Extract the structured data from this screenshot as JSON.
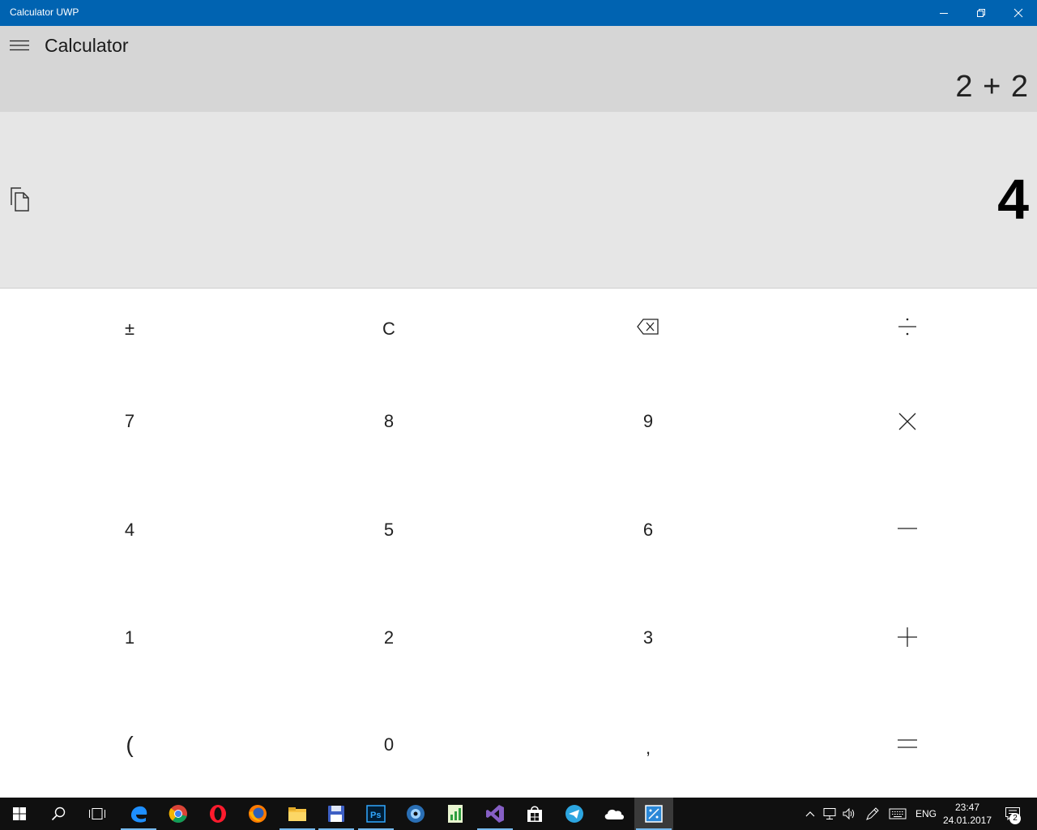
{
  "window": {
    "title": "Calculator UWP"
  },
  "header": {
    "title": "Calculator",
    "expression": "2 + 2"
  },
  "display": {
    "result": "4"
  },
  "keypad": {
    "row0": [
      "±",
      "C",
      "backspace",
      "÷"
    ],
    "row1": [
      "7",
      "8",
      "9",
      "×"
    ],
    "row2": [
      "4",
      "5",
      "6",
      "−"
    ],
    "row3": [
      "1",
      "2",
      "3",
      "+"
    ],
    "row4": [
      "(",
      "0",
      ",",
      "="
    ],
    "labels": {
      "plus_minus": "±",
      "clear": "C",
      "seven": "7",
      "eight": "8",
      "nine": "9",
      "four": "4",
      "five": "5",
      "six": "6",
      "one": "1",
      "two": "2",
      "three": "3",
      "paren": "(",
      "zero": "0",
      "comma": ","
    }
  },
  "taskbar": {
    "language": "ENG",
    "time": "23:47",
    "date": "24.01.2017",
    "notifications": "2",
    "colors": {
      "accent": "#0063b1",
      "taskbar_bg": "#101010",
      "active_indicator": "#76b9ed"
    }
  }
}
